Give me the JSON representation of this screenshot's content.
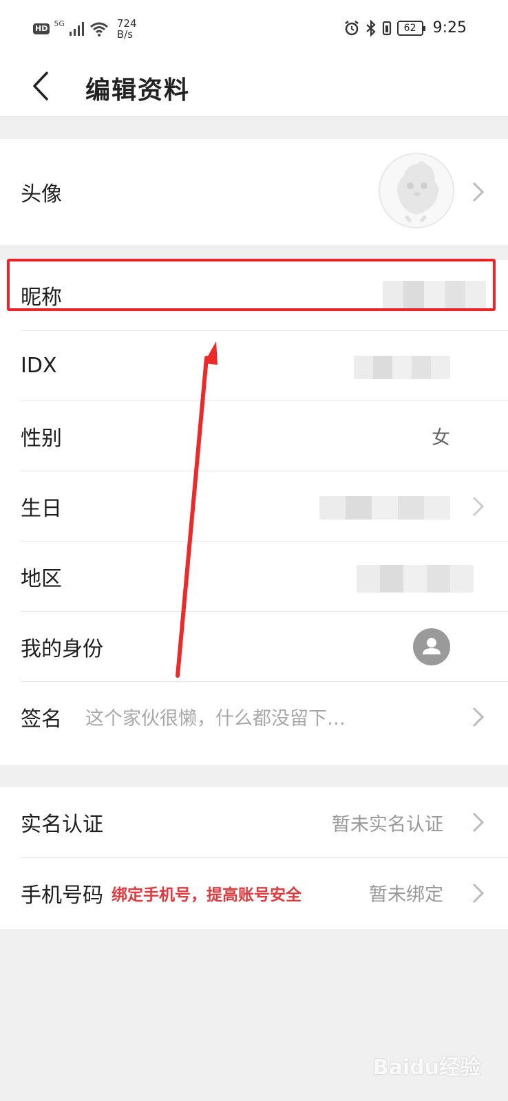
{
  "status_bar": {
    "hd": "HD",
    "network": "5G",
    "speed_value": "724",
    "speed_unit": "B/s",
    "battery": "62",
    "time": "9:25"
  },
  "header": {
    "title": "编辑资料"
  },
  "profile": {
    "avatar_label": "头像",
    "nickname_label": "昵称",
    "idx_label": "IDX",
    "gender_label": "性别",
    "gender_value": "女",
    "birthday_label": "生日",
    "region_label": "地区",
    "identity_label": "我的身份",
    "signature_label": "签名",
    "signature_placeholder": "这个家伙很懒，什么都没留下…"
  },
  "account": {
    "realname_label": "实名认证",
    "realname_value": "暂未实名认证",
    "phone_label": "手机号码",
    "phone_hint": "绑定手机号，提高账号安全",
    "phone_value": "暂未绑定"
  },
  "annotation": {
    "highlight_color": "#e8262a"
  },
  "watermark": {
    "text": "Baidu经验"
  }
}
